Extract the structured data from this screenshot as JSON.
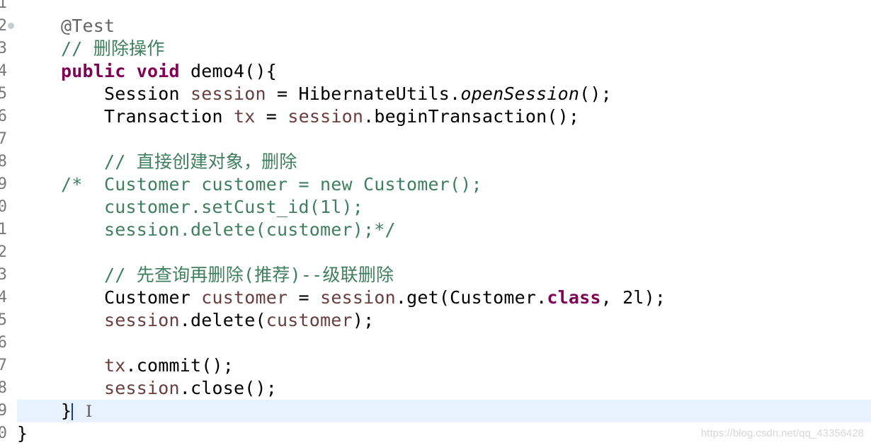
{
  "editor": {
    "language": "java",
    "current_line": 19,
    "colors": {
      "keyword": "#7f0055",
      "comment": "#3f7f5f",
      "variable": "#6a3e3e",
      "current_line": "#e8f2fe"
    },
    "lines": [
      {
        "n": "1",
        "tokens": []
      },
      {
        "n": "2",
        "fold": true,
        "tokens": [
          {
            "t": "@Test",
            "c": "ann"
          }
        ]
      },
      {
        "n": "3",
        "tokens": [
          {
            "t": "// 删除操作",
            "c": "cm"
          }
        ]
      },
      {
        "n": "4",
        "tokens": [
          {
            "t": "public",
            "c": "kw"
          },
          {
            "t": " "
          },
          {
            "t": "void",
            "c": "kw"
          },
          {
            "t": " demo4(){"
          }
        ]
      },
      {
        "n": "5",
        "tokens": [
          {
            "t": "    Session "
          },
          {
            "t": "session",
            "c": "var"
          },
          {
            "t": " = HibernateUtils."
          },
          {
            "t": "openSession",
            "c": "it"
          },
          {
            "t": "();"
          }
        ]
      },
      {
        "n": "6",
        "tokens": [
          {
            "t": "    Transaction "
          },
          {
            "t": "tx",
            "c": "var"
          },
          {
            "t": " = "
          },
          {
            "t": "session",
            "c": "var"
          },
          {
            "t": ".beginTransaction();"
          }
        ]
      },
      {
        "n": "7",
        "tokens": []
      },
      {
        "n": "8",
        "tokens": [
          {
            "t": "    // 直接创建对象，删除",
            "c": "cm"
          }
        ]
      },
      {
        "n": "9",
        "tokens": [
          {
            "t": "/*  Customer customer = new Customer();",
            "c": "cm"
          }
        ]
      },
      {
        "n": "0",
        "tokens": [
          {
            "t": "    customer.setCust_id(1l);",
            "c": "cm"
          }
        ]
      },
      {
        "n": "1",
        "tokens": [
          {
            "t": "    session.delete(customer);*/",
            "c": "cm"
          }
        ]
      },
      {
        "n": "2",
        "tokens": []
      },
      {
        "n": "3",
        "tokens": [
          {
            "t": "    // 先查询再删除(推荐)--级联删除",
            "c": "cm"
          }
        ]
      },
      {
        "n": "4",
        "tokens": [
          {
            "t": "    Customer "
          },
          {
            "t": "customer",
            "c": "var"
          },
          {
            "t": " = "
          },
          {
            "t": "session",
            "c": "var"
          },
          {
            "t": ".get(Customer."
          },
          {
            "t": "class",
            "c": "kw"
          },
          {
            "t": ", 2l);"
          }
        ]
      },
      {
        "n": "5",
        "tokens": [
          {
            "t": "    "
          },
          {
            "t": "session",
            "c": "var"
          },
          {
            "t": ".delete("
          },
          {
            "t": "customer",
            "c": "var"
          },
          {
            "t": ");"
          }
        ]
      },
      {
        "n": "6",
        "tokens": []
      },
      {
        "n": "7",
        "tokens": [
          {
            "t": "    "
          },
          {
            "t": "tx",
            "c": "var"
          },
          {
            "t": ".commit();"
          }
        ]
      },
      {
        "n": "8",
        "tokens": [
          {
            "t": "    "
          },
          {
            "t": "session",
            "c": "var"
          },
          {
            "t": ".close();"
          }
        ]
      },
      {
        "n": "9",
        "current": true,
        "tokens": [
          {
            "t": "}"
          }
        ]
      },
      {
        "n": "0",
        "tokens": [
          {
            "t": "}",
            "outer": true
          }
        ]
      }
    ]
  },
  "watermark": "https://blog.csdn.net/qq_43356428"
}
